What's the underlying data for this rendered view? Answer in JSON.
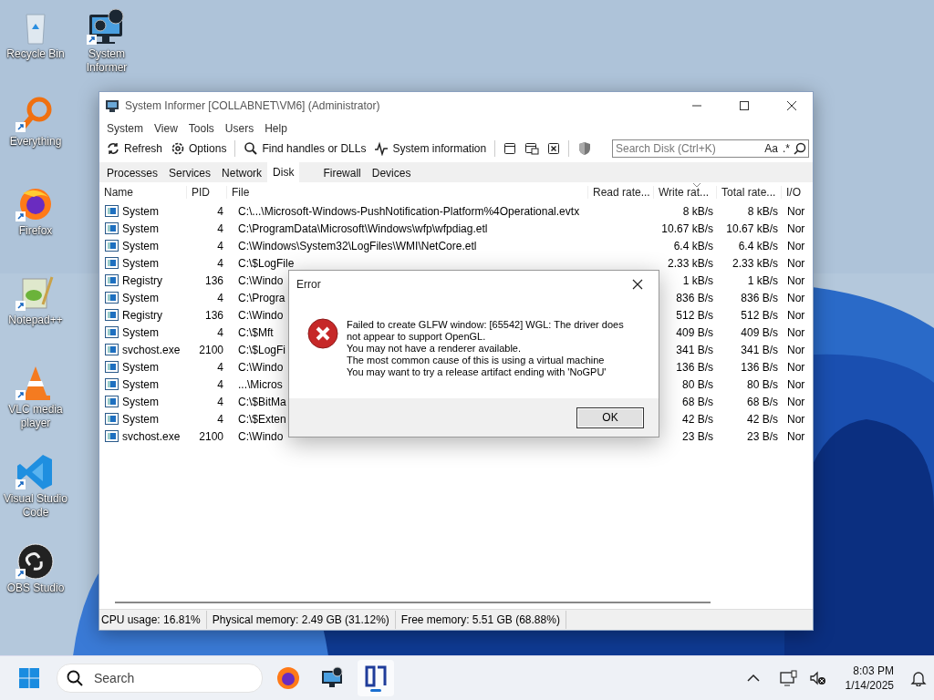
{
  "desktop_icons": [
    {
      "label": "Recycle Bin",
      "shortcut": false
    },
    {
      "label": "System Informer",
      "shortcut": true
    },
    {
      "label": "Everything",
      "shortcut": true
    },
    {
      "label": "Firefox",
      "shortcut": true
    },
    {
      "label": "Notepad++",
      "shortcut": true
    },
    {
      "label": "VLC media player",
      "shortcut": true
    },
    {
      "label": "Visual Studio Code",
      "shortcut": true
    },
    {
      "label": "OBS Studio",
      "shortcut": true
    }
  ],
  "window": {
    "title": "System Informer [COLLABNET\\VM6] (Administrator)",
    "menu": [
      "System",
      "View",
      "Tools",
      "Users",
      "Help"
    ],
    "toolbar": [
      {
        "kind": "refresh",
        "label": "Refresh"
      },
      {
        "kind": "options",
        "label": "Options"
      },
      {
        "kind": "find",
        "label": "Find handles or DLLs"
      },
      {
        "kind": "sysinfo",
        "label": "System information"
      }
    ],
    "search": {
      "placeholder": "Search Disk (Ctrl+K)",
      "case_toggle": "Aa",
      "regex_toggle": ".*"
    },
    "tabs": [
      {
        "label": "Processes",
        "selected": false
      },
      {
        "label": "Services",
        "selected": false
      },
      {
        "label": "Network",
        "selected": false
      },
      {
        "label": "Disk",
        "selected": true
      },
      {
        "label": "Firewall",
        "selected": false
      },
      {
        "label": "Devices",
        "selected": false
      }
    ],
    "table": {
      "columns": [
        "Name",
        "PID",
        "File",
        "Read rate...",
        "Write rat...",
        "Total rate...",
        "I/O"
      ],
      "rows": [
        {
          "name": "System",
          "pid": "4",
          "file": "C:\\...\\Microsoft-Windows-PushNotification-Platform%4Operational.evtx",
          "write_rate": "8 kB/s",
          "total_rate": "8 kB/s",
          "io": "Nor"
        },
        {
          "name": "System",
          "pid": "4",
          "file": "C:\\ProgramData\\Microsoft\\Windows\\wfp\\wfpdiag.etl",
          "write_rate": "10.67 kB/s",
          "total_rate": "10.67 kB/s",
          "io": "Nor"
        },
        {
          "name": "System",
          "pid": "4",
          "file": "C:\\Windows\\System32\\LogFiles\\WMI\\NetCore.etl",
          "write_rate": "6.4 kB/s",
          "total_rate": "6.4 kB/s",
          "io": "Nor"
        },
        {
          "name": "System",
          "pid": "4",
          "file": "C:\\$LogFile",
          "write_rate": "2.33 kB/s",
          "total_rate": "2.33 kB/s",
          "io": "Nor"
        },
        {
          "name": "Registry",
          "pid": "136",
          "file": "C:\\Windo",
          "write_rate": "1 kB/s",
          "total_rate": "1 kB/s",
          "io": "Nor"
        },
        {
          "name": "System",
          "pid": "4",
          "file": "C:\\Progra",
          "write_rate": "836 B/s",
          "total_rate": "836 B/s",
          "io": "Nor"
        },
        {
          "name": "Registry",
          "pid": "136",
          "file": "C:\\Windo",
          "write_rate": "512 B/s",
          "total_rate": "512 B/s",
          "io": "Nor"
        },
        {
          "name": "System",
          "pid": "4",
          "file": "C:\\$Mft",
          "write_rate": "409 B/s",
          "total_rate": "409 B/s",
          "io": "Nor"
        },
        {
          "name": "svchost.exe",
          "pid": "2100",
          "file": "C:\\$LogFi",
          "write_rate": "341 B/s",
          "total_rate": "341 B/s",
          "io": "Nor"
        },
        {
          "name": "System",
          "pid": "4",
          "file": "C:\\Windo",
          "write_rate": "136 B/s",
          "total_rate": "136 B/s",
          "io": "Nor"
        },
        {
          "name": "System",
          "pid": "4",
          "file": "...\\Micros",
          "write_rate": "80 B/s",
          "total_rate": "80 B/s",
          "io": "Nor"
        },
        {
          "name": "System",
          "pid": "4",
          "file": "C:\\$BitMa",
          "write_rate": "68 B/s",
          "total_rate": "68 B/s",
          "io": "Nor"
        },
        {
          "name": "System",
          "pid": "4",
          "file": "C:\\$Exten",
          "write_rate": "42 B/s",
          "total_rate": "42 B/s",
          "io": "Nor"
        },
        {
          "name": "svchost.exe",
          "pid": "2100",
          "file": "C:\\Windo",
          "write_rate": "23 B/s",
          "total_rate": "23 B/s",
          "io": "Nor"
        }
      ]
    },
    "status_bar": [
      "CPU usage: 16.81%",
      "Physical memory: 2.49 GB (31.12%)",
      "Free memory: 5.51 GB (68.88%)"
    ]
  },
  "dialog": {
    "title": "Error",
    "lines": [
      "Failed to create GLFW window: [65542] WGL: The driver does not appear to support OpenGL.",
      "You may not have a renderer available.",
      "The most common cause of this is using a virtual machine",
      "You may want to try a release artifact ending with 'NoGPU'"
    ],
    "button": "OK"
  },
  "taskbar": {
    "search_placeholder": "Search",
    "time": "8:03 PM",
    "date": "1/14/2025"
  }
}
